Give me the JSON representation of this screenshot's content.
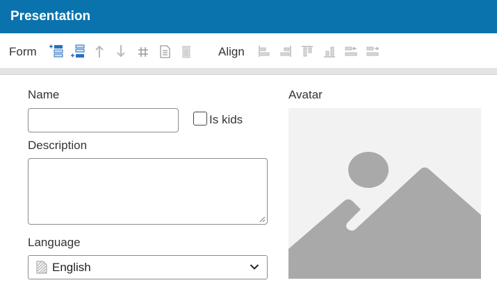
{
  "window": {
    "title": "Presentation"
  },
  "toolbar": {
    "form_label": "Form",
    "align_label": "Align",
    "form_icons": [
      "insert-row-above-icon",
      "insert-row-below-icon",
      "move-up-icon",
      "move-down-icon",
      "grid-icon",
      "document-icon",
      "delete-icon"
    ],
    "align_icons": [
      "align-left-icon",
      "align-right-icon",
      "align-top-icon",
      "align-bottom-icon",
      "distribute-left-icon",
      "distribute-right-icon"
    ]
  },
  "form": {
    "name_label": "Name",
    "name_value": "",
    "is_kids_label": "Is kids",
    "is_kids_checked": false,
    "description_label": "Description",
    "description_value": "",
    "language_label": "Language",
    "language_value": "English",
    "avatar_label": "Avatar"
  },
  "colors": {
    "header": "#0a73ad",
    "icon_blue": "#2c6fbd",
    "icon_gray": "#b8b8b8",
    "placeholder_gray": "#a9a9a9"
  }
}
